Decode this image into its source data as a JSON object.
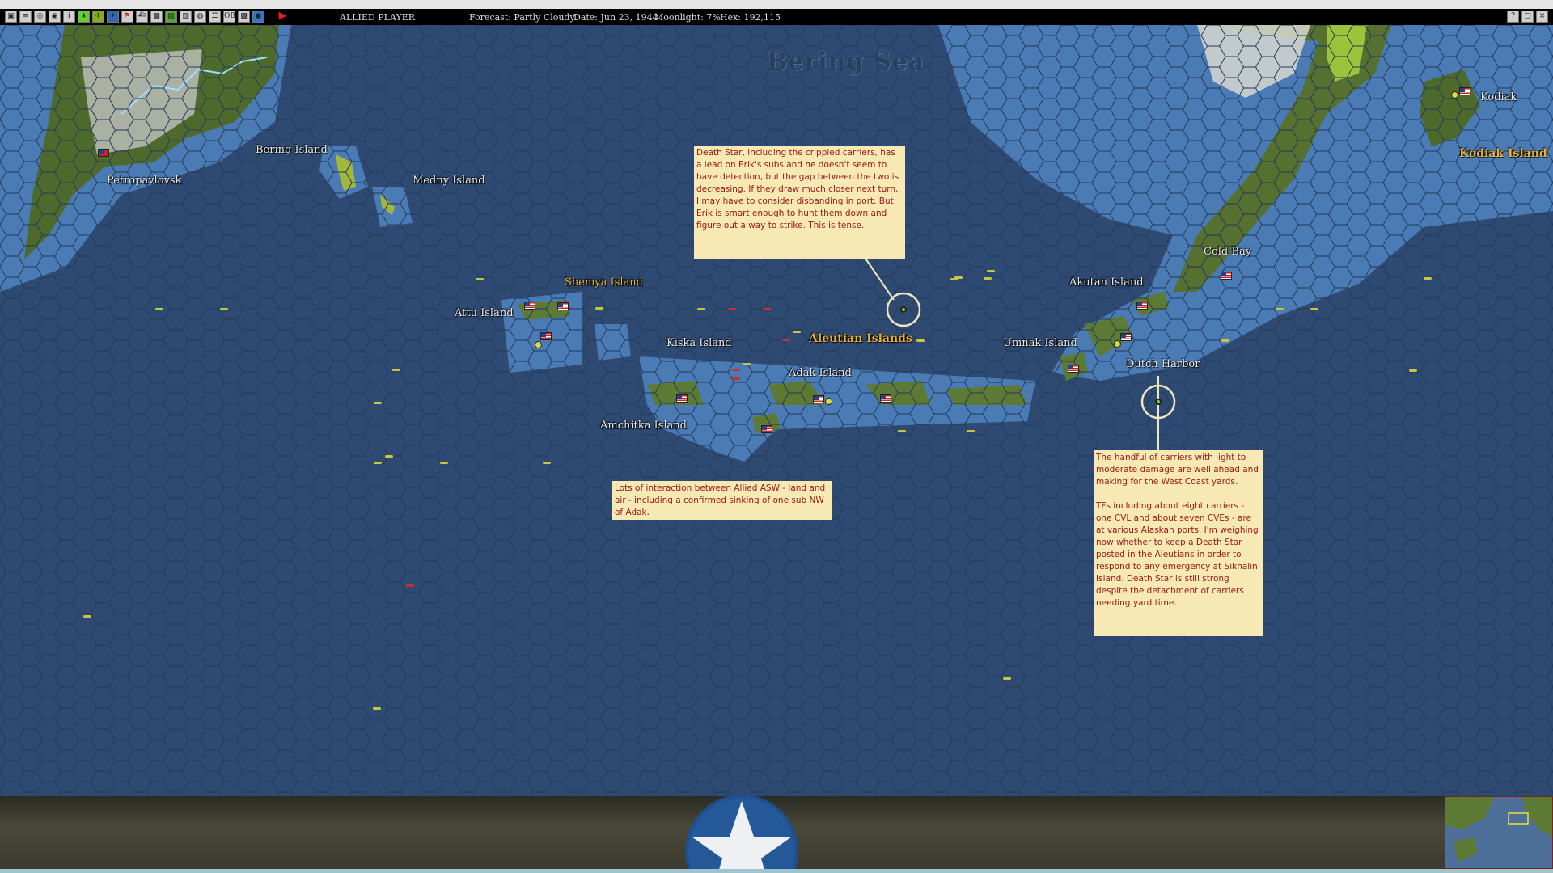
{
  "toolbar": {
    "player": "ALLIED PLAYER",
    "forecast": "Forecast: Partly Cloudy",
    "date": "Date: Jun 23, 1944",
    "moonlight": "Moonlight: 7%",
    "hex": "Hex: 192,115",
    "icons": [
      "save-icon",
      "menu-icon",
      "globe-icon",
      "report-icon",
      "info-icon",
      "star-icon",
      "air-icon",
      "fleet-icon",
      "flag-icon",
      "ship-icon",
      "unit-icon",
      "chart-icon",
      "base-icon",
      "target-icon",
      "list-icon",
      "ob-icon",
      "grid-icon",
      "map-icon"
    ],
    "right_icons": [
      "help-icon",
      "window-icon",
      "close-icon"
    ],
    "end_turn_icon": "play-icon"
  },
  "map": {
    "sea_title": "Bering Sea",
    "labels": {
      "petropavlovsk": "Petropavlovsk",
      "bering_island": "Bering Island",
      "medny_island": "Medny Island",
      "attu_island": "Attu Island",
      "shemya_island": "Shemya Island",
      "kiska_island": "Kiska Island",
      "aleutian_islands": "Aleutian Islands",
      "adak_island": "Adak Island",
      "amchitka_island": "Amchitka Island",
      "umnak_island": "Umnak Island",
      "akutan_island": "Akutan Island",
      "dutch_harbor": "Dutch Harbor",
      "cold_bay": "Cold Bay",
      "kodiak": "Kodiak",
      "kodiak_island": "Kodiak Island"
    },
    "notes": {
      "death_star": "Death Star, including the crippled carriers, has a lead on Erik's subs and he doesn't seem to have detection, but the gap between the two is decreasing.  If they draw much closer next turn, I may have to consider disbanding in port.  But Erik is smart enough to hunt them down and figure out a way to strike.  This is tense.",
      "asw": "Lots of interaction between Allied ASW - land and air - including a confirmed sinking of one sub NW of Adak.",
      "carriers_p1": "The handful of carriers with light to moderate damage are well ahead and making for the West Coast yards.",
      "carriers_p2": "TFs including about eight carriers - one CVL and about seven CVEs - are at various Alaskan ports.  I'm weighing now whether to keep a Death Star posted in the Aleutians in order to respond to any emergency at Sikhalin Island.  Death Star is still strong despite the detachment of carriers needing yard time."
    },
    "colors": {
      "ocean_deep": "#2e4a72",
      "ocean_shallow": "#4a7bb4",
      "land": "#4d6a2c",
      "note_bg": "#f6e9b3",
      "note_text": "#a01818",
      "label_gold": "#e8b23a"
    }
  },
  "bottom": {
    "emblem_icon": "us-star-roundel-icon",
    "minimap_icon": "minimap-icon"
  }
}
